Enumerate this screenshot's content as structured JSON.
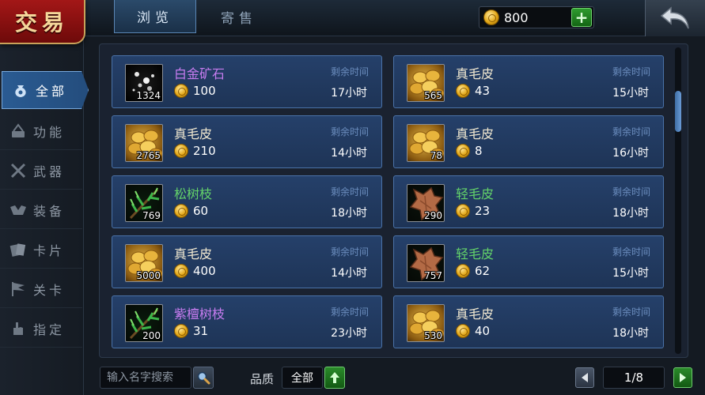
{
  "header": {
    "title": "交易",
    "tabs": [
      {
        "label": "浏览",
        "active": true
      },
      {
        "label": "寄售",
        "active": false
      }
    ],
    "gold": "800",
    "add_icon": "plus-icon",
    "back_icon": "back-arrow-icon"
  },
  "sidebar": {
    "items": [
      {
        "label": "全部",
        "icon": "money-bag-icon",
        "active": true
      },
      {
        "label": "功能",
        "icon": "function-icon",
        "active": false
      },
      {
        "label": "武器",
        "icon": "weapon-icon",
        "active": false
      },
      {
        "label": "装备",
        "icon": "armor-icon",
        "active": false
      },
      {
        "label": "卡片",
        "icon": "card-icon",
        "active": false
      },
      {
        "label": "关卡",
        "icon": "flag-icon",
        "active": false
      },
      {
        "label": "指定",
        "icon": "hand-icon",
        "active": false
      }
    ]
  },
  "listings": [
    {
      "name": "白金矿石",
      "price": "100",
      "quantity": "1324",
      "time_label": "剩余时间",
      "time": "17小时",
      "thumb": "ore",
      "name_color": "#c77cf0"
    },
    {
      "name": "真毛皮",
      "price": "43",
      "quantity": "565",
      "time_label": "剩余时间",
      "time": "15小时",
      "thumb": "fur",
      "name_color": "#f0e8d0"
    },
    {
      "name": "真毛皮",
      "price": "210",
      "quantity": "2765",
      "time_label": "剩余时间",
      "time": "14小时",
      "thumb": "fur",
      "name_color": "#f0e8d0"
    },
    {
      "name": "真毛皮",
      "price": "8",
      "quantity": "78",
      "time_label": "剩余时间",
      "time": "16小时",
      "thumb": "fur",
      "name_color": "#f0e8d0"
    },
    {
      "name": "松树枝",
      "price": "60",
      "quantity": "769",
      "time_label": "剩余时间",
      "time": "18小时",
      "thumb": "branch",
      "name_color": "#63d26a"
    },
    {
      "name": "轻毛皮",
      "price": "23",
      "quantity": "290",
      "time_label": "剩余时间",
      "time": "18小时",
      "thumb": "hide",
      "name_color": "#63d26a"
    },
    {
      "name": "真毛皮",
      "price": "400",
      "quantity": "5000",
      "time_label": "剩余时间",
      "time": "14小时",
      "thumb": "fur",
      "name_color": "#f0e8d0"
    },
    {
      "name": "轻毛皮",
      "price": "62",
      "quantity": "757",
      "time_label": "剩余时间",
      "time": "15小时",
      "thumb": "hide",
      "name_color": "#63d26a"
    },
    {
      "name": "紫檀树枝",
      "price": "31",
      "quantity": "200",
      "time_label": "剩余时间",
      "time": "23小时",
      "thumb": "branch",
      "name_color": "#c77cf0"
    },
    {
      "name": "真毛皮",
      "price": "40",
      "quantity": "530",
      "time_label": "剩余时间",
      "time": "18小时",
      "thumb": "fur",
      "name_color": "#f0e8d0"
    }
  ],
  "footer": {
    "search_placeholder": "输入名字搜索",
    "search_icon": "magnifier-icon",
    "quality_label": "品质",
    "quality_value": "全部",
    "quality_icon": "up-arrow-icon",
    "page": "1/8",
    "prev_icon": "left-triangle-icon",
    "next_icon": "right-triangle-icon"
  }
}
